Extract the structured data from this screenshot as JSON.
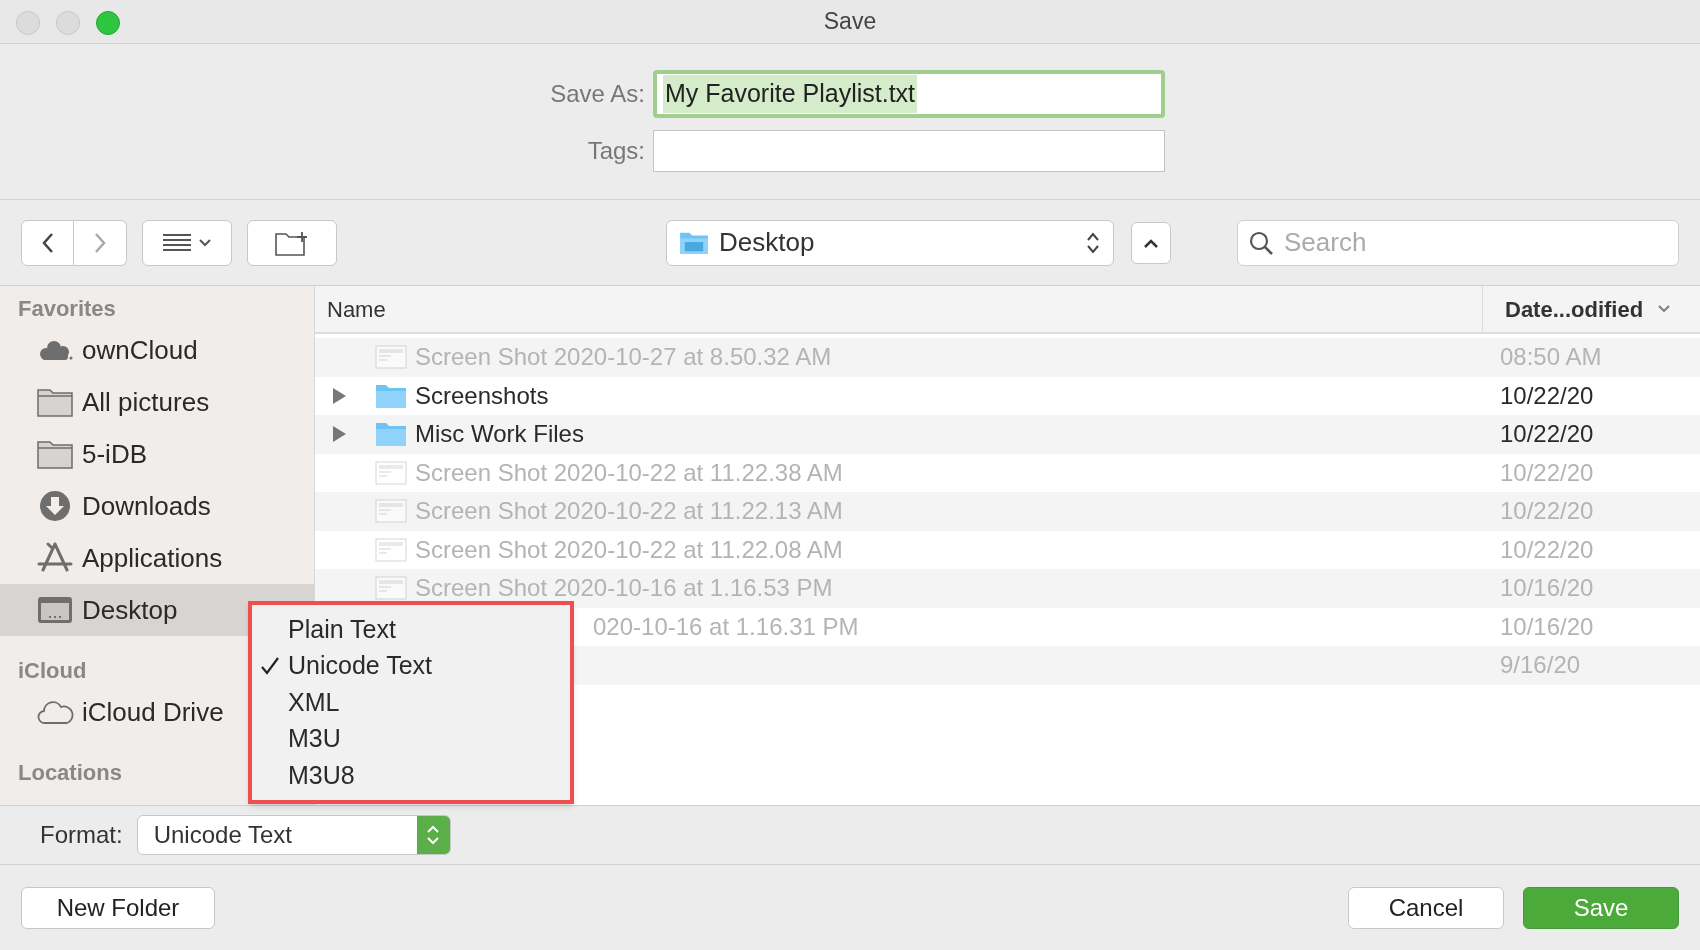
{
  "window": {
    "title": "Save"
  },
  "save_as": {
    "label": "Save As:",
    "value": "My Favorite Playlist.txt"
  },
  "tags": {
    "label": "Tags:"
  },
  "toolbar": {
    "location": "Desktop",
    "search_placeholder": "Search"
  },
  "sidebar": {
    "sections": [
      {
        "title": "Favorites",
        "items": [
          {
            "label": "ownCloud",
            "kind": "cloud-cluster",
            "selected": false
          },
          {
            "label": "All pictures",
            "kind": "folder",
            "selected": false
          },
          {
            "label": "5-iDB",
            "kind": "folder",
            "selected": false
          },
          {
            "label": "Downloads",
            "kind": "download",
            "selected": false
          },
          {
            "label": "Applications",
            "kind": "apps",
            "selected": false
          },
          {
            "label": "Desktop",
            "kind": "desktop",
            "selected": true
          }
        ]
      },
      {
        "title": "iCloud",
        "items": [
          {
            "label": "iCloud Drive",
            "kind": "cloud",
            "selected": false
          }
        ]
      },
      {
        "title": "Locations"
      }
    ]
  },
  "file_list": {
    "columns": [
      "Name",
      "Date...odified"
    ],
    "rows": [
      {
        "name": "Screen Shot 2020-10-27 at 8.50.32 AM",
        "date": "08:50 AM",
        "kind": "image",
        "disabled": true
      },
      {
        "name": "Screenshots",
        "date": "10/22/20",
        "kind": "folder",
        "disabled": false
      },
      {
        "name": "Misc Work Files",
        "date": "10/22/20",
        "kind": "folder",
        "disabled": false
      },
      {
        "name": "Screen Shot 2020-10-22 at 11.22.38 AM",
        "date": "10/22/20",
        "kind": "image",
        "disabled": true
      },
      {
        "name": "Screen Shot 2020-10-22 at 11.22.13 AM",
        "date": "10/22/20",
        "kind": "image",
        "disabled": true
      },
      {
        "name": "Screen Shot 2020-10-22 at 11.22.08 AM",
        "date": "10/22/20",
        "kind": "image",
        "disabled": true
      },
      {
        "name": "Screen Shot 2020-10-16 at 1.16.53 PM",
        "date": "10/16/20",
        "kind": "image",
        "disabled": true
      },
      {
        "name": "020-10-16 at 1.16.31 PM",
        "date": "10/16/20",
        "kind": "covered",
        "disabled": true
      },
      {
        "date": "9/16/20",
        "kind": "covered",
        "disabled": true
      }
    ]
  },
  "format_menu": {
    "items": [
      {
        "label": "Plain Text",
        "checked": false
      },
      {
        "label": "Unicode Text",
        "checked": true
      },
      {
        "label": "XML",
        "checked": false
      },
      {
        "label": "M3U",
        "checked": false
      },
      {
        "label": "M3U8",
        "checked": false
      }
    ]
  },
  "format": {
    "label": "Format:",
    "value": "Unicode Text"
  },
  "buttons": {
    "new_folder": "New Folder",
    "cancel": "Cancel",
    "save": "Save"
  }
}
